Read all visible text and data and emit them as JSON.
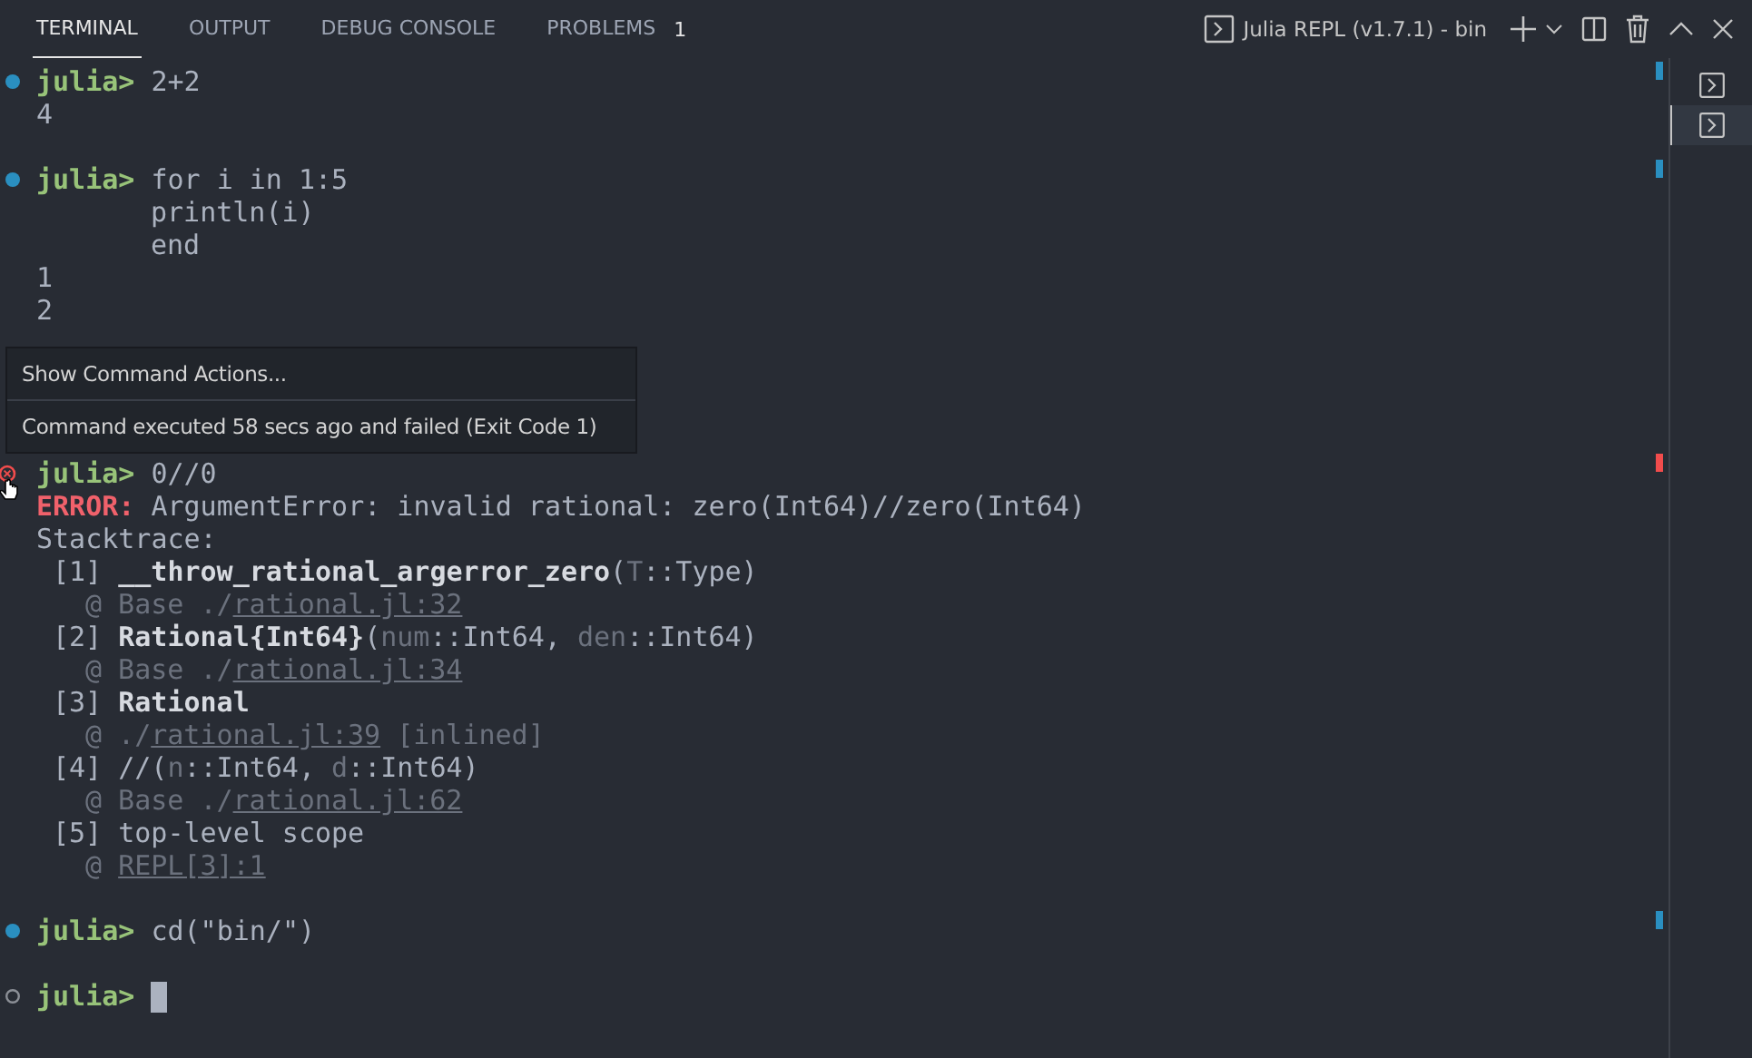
{
  "panel_tabs": [
    {
      "label": "TERMINAL",
      "selected": true
    },
    {
      "label": "OUTPUT",
      "selected": false
    },
    {
      "label": "DEBUG CONSOLE",
      "selected": false
    },
    {
      "label": "PROBLEMS",
      "selected": false,
      "badge": "1"
    }
  ],
  "terminal_title": "Julia REPL (v1.7.1) - bin",
  "terminal_instances": [
    {
      "selected": false
    },
    {
      "selected": true
    }
  ],
  "lines": [
    {
      "kind": "prompt",
      "decoration": {
        "kind": "success"
      },
      "prompt": "julia>",
      "code": "2+2"
    },
    {
      "kind": "output",
      "text": "4"
    },
    {
      "kind": "blank"
    },
    {
      "kind": "prompt",
      "decoration": {
        "kind": "success"
      },
      "prompt": "julia>",
      "code": "for i in 1:5"
    },
    {
      "kind": "continuation",
      "text": "println(i)"
    },
    {
      "kind": "continuation",
      "text": "end"
    },
    {
      "kind": "output",
      "text": "1"
    },
    {
      "kind": "output",
      "text": "2"
    },
    {
      "kind": "blank"
    },
    {
      "kind": "blank"
    },
    {
      "kind": "blank"
    },
    {
      "kind": "blank"
    },
    {
      "kind": "prompt",
      "decoration": {
        "kind": "error"
      },
      "prompt": "julia>",
      "code": "0//0"
    },
    {
      "kind": "error",
      "label": "ERROR:",
      "text": "ArgumentError: invalid rational: zero(Int64)//zero(Int64)"
    },
    {
      "kind": "output",
      "text": "Stacktrace:"
    },
    {
      "kind": "frame",
      "index": "[1]",
      "parts": [
        {
          "kind": "bold",
          "text": "__throw_rational_argerror_zero"
        },
        {
          "kind": "plain",
          "text": "("
        },
        {
          "kind": "dim",
          "text": "T"
        },
        {
          "kind": "plain",
          "text": "::Type)"
        }
      ]
    },
    {
      "kind": "location",
      "parts": [
        {
          "kind": "dim",
          "text": "@ Base ./"
        },
        {
          "kind": "link",
          "text": "rational.jl:32"
        }
      ]
    },
    {
      "kind": "frame",
      "index": "[2]",
      "parts": [
        {
          "kind": "bold",
          "text": "Rational{Int64}"
        },
        {
          "kind": "plain",
          "text": "("
        },
        {
          "kind": "dim",
          "text": "num"
        },
        {
          "kind": "plain",
          "text": "::Int64, "
        },
        {
          "kind": "dim",
          "text": "den"
        },
        {
          "kind": "plain",
          "text": "::Int64)"
        }
      ]
    },
    {
      "kind": "location",
      "parts": [
        {
          "kind": "dim",
          "text": "@ Base ./"
        },
        {
          "kind": "link",
          "text": "rational.jl:34"
        }
      ]
    },
    {
      "kind": "frame",
      "index": "[3]",
      "parts": [
        {
          "kind": "bold",
          "text": "Rational"
        }
      ]
    },
    {
      "kind": "location",
      "parts": [
        {
          "kind": "dim",
          "text": "@ ./"
        },
        {
          "kind": "link",
          "text": "rational.jl:39"
        },
        {
          "kind": "dim",
          "text": " [inlined]"
        }
      ]
    },
    {
      "kind": "frame",
      "index": "[4]",
      "parts": [
        {
          "kind": "plain",
          "text": "//("
        },
        {
          "kind": "dim",
          "text": "n"
        },
        {
          "kind": "plain",
          "text": "::Int64, "
        },
        {
          "kind": "dim",
          "text": "d"
        },
        {
          "kind": "plain",
          "text": "::Int64)"
        }
      ]
    },
    {
      "kind": "location",
      "parts": [
        {
          "kind": "dim",
          "text": "@ Base ./"
        },
        {
          "kind": "link",
          "text": "rational.jl:62"
        }
      ]
    },
    {
      "kind": "frame",
      "index": "[5]",
      "parts": [
        {
          "kind": "plain",
          "text": "top-level scope"
        }
      ]
    },
    {
      "kind": "location",
      "parts": [
        {
          "kind": "dim",
          "text": "@ "
        },
        {
          "kind": "link",
          "text": "REPL[3]:1"
        }
      ]
    },
    {
      "kind": "blank"
    },
    {
      "kind": "prompt",
      "decoration": {
        "kind": "success"
      },
      "prompt": "julia>",
      "code": "cd(\"bin/\")"
    },
    {
      "kind": "blank"
    },
    {
      "kind": "prompt",
      "decoration": {
        "kind": "none"
      },
      "prompt": "julia>",
      "cursor": true
    }
  ],
  "hover_popup": {
    "action": "Show Command Actions...",
    "status": "Command executed 58 secs ago and failed (Exit Code 1)"
  }
}
